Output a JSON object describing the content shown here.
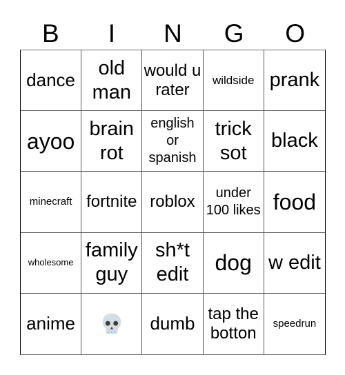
{
  "header": {
    "letters": [
      "B",
      "I",
      "N",
      "G",
      "O"
    ]
  },
  "grid": {
    "rows": [
      [
        {
          "text": "dance",
          "size": "m"
        },
        {
          "text": "old man",
          "size": "l"
        },
        {
          "text": "would u rater",
          "size": "ms"
        },
        {
          "text": "wildside",
          "size": "xs"
        },
        {
          "text": "prank",
          "size": "l"
        }
      ],
      [
        {
          "text": "ayoo",
          "size": "xl"
        },
        {
          "text": "brain rot",
          "size": "l"
        },
        {
          "text": "english or spanish",
          "size": "s"
        },
        {
          "text": "trick sot",
          "size": "l"
        },
        {
          "text": "black",
          "size": "l"
        }
      ],
      [
        {
          "text": "minecraft",
          "size": "xxs"
        },
        {
          "text": "fortnite",
          "size": "ms"
        },
        {
          "text": "roblox",
          "size": "ms"
        },
        {
          "text": "under 100 likes",
          "size": "s"
        },
        {
          "text": "food",
          "size": "xl"
        }
      ],
      [
        {
          "text": "wholesome",
          "size": "tiny"
        },
        {
          "text": "family guy",
          "size": "l"
        },
        {
          "text": "sh*t edit",
          "size": "l"
        },
        {
          "text": "dog",
          "size": "xl"
        },
        {
          "text": "w edit",
          "size": "l"
        }
      ],
      [
        {
          "text": "anime",
          "size": "m"
        },
        {
          "icon": "skull-emoji"
        },
        {
          "text": "dumb",
          "size": "m"
        },
        {
          "text": "tap the botton",
          "size": "ms"
        },
        {
          "text": "speedrun",
          "size": "xxs"
        }
      ]
    ]
  }
}
